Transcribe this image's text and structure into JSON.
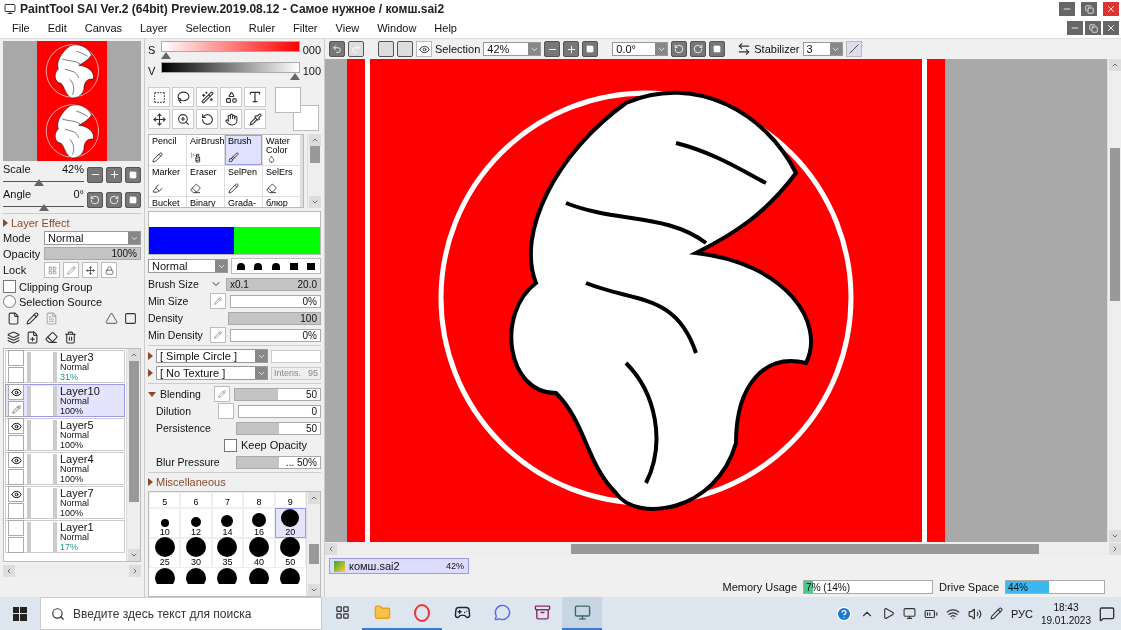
{
  "window": {
    "title": "PaintTool SAI Ver.2 (64bit) Preview.2019.08.12 - Самое нужное / комш.sai2"
  },
  "menu": [
    {
      "label": "File"
    },
    {
      "label": "Edit"
    },
    {
      "label": "Canvas"
    },
    {
      "label": "Layer"
    },
    {
      "label": "Selection"
    },
    {
      "label": "Ruler"
    },
    {
      "label": "Filter"
    },
    {
      "label": "View"
    },
    {
      "label": "Window"
    },
    {
      "label": "Help"
    }
  ],
  "navigator": {
    "scale": {
      "label": "Scale",
      "value": "42%",
      "level": 0.45
    },
    "angle": {
      "label": "Angle",
      "value": "0°",
      "level": 0.5
    }
  },
  "layer_effect": {
    "header": "Layer Effect",
    "mode": {
      "label": "Mode",
      "value": "Normal"
    },
    "opacity": {
      "label": "Opacity",
      "value": "100%",
      "level": 1
    },
    "lock": {
      "label": "Lock"
    },
    "clipping_group": {
      "label": "Clipping Group",
      "checked": false
    },
    "selection_source": {
      "label": "Selection Source",
      "selected": false
    }
  },
  "layers": [
    {
      "name": "Layer3",
      "mode": "Normal",
      "opacity": "31%",
      "reduced": true,
      "visible": false,
      "editing": false,
      "selected": false
    },
    {
      "name": "Layer10",
      "mode": "Normal",
      "opacity": "100%",
      "reduced": false,
      "visible": true,
      "editing": true,
      "selected": true
    },
    {
      "name": "Layer5",
      "mode": "Normal",
      "opacity": "100%",
      "reduced": false,
      "visible": true,
      "editing": false,
      "selected": false
    },
    {
      "name": "Layer4",
      "mode": "Normal",
      "opacity": "100%",
      "reduced": false,
      "visible": true,
      "editing": false,
      "selected": false
    },
    {
      "name": "Layer7",
      "mode": "Normal",
      "opacity": "100%",
      "reduced": false,
      "visible": true,
      "editing": false,
      "selected": false
    },
    {
      "name": "Layer1",
      "mode": "Normal",
      "opacity": "17%",
      "reduced": true,
      "visible": false,
      "editing": false,
      "selected": false
    }
  ],
  "color": {
    "s": {
      "label": "S",
      "value": "000",
      "level": 0
    },
    "v": {
      "label": "V",
      "value": "100",
      "level": 1
    }
  },
  "brush_tools": [
    {
      "label": "Pencil",
      "selected": false
    },
    {
      "label": "AirBrush",
      "selected": false
    },
    {
      "label": "Brush",
      "selected": true
    },
    {
      "label": "Water Color",
      "selected": false
    },
    {
      "label": "Marker",
      "selected": false
    },
    {
      "label": "Eraser",
      "selected": false
    },
    {
      "label": "SelPen",
      "selected": false
    },
    {
      "label": "SelErs",
      "selected": false
    },
    {
      "label": "Bucket",
      "selected": false
    },
    {
      "label": "Binary",
      "selected": false
    },
    {
      "label": "Grada-",
      "selected": false
    },
    {
      "label": "блюр",
      "selected": false
    }
  ],
  "brush": {
    "mode": "Normal",
    "params": [
      {
        "label": "Brush Size",
        "prefix": "x0.1",
        "value": "20.0",
        "level": 1
      },
      {
        "label": "Min Size",
        "value": "0%",
        "level": 0
      },
      {
        "label": "Density",
        "value": "100",
        "level": 1
      },
      {
        "label": "Min Density",
        "value": "0%",
        "level": 0
      }
    ],
    "shape": "[ Simple Circle ]",
    "texture": "[ No Texture ]",
    "intensity": "Intens.",
    "intensity_value": "95",
    "blending": [
      {
        "label": "Blending",
        "value": "50",
        "level": 0.5
      },
      {
        "label": "Dilution",
        "value": "0",
        "level": 0,
        "checked": false
      },
      {
        "label": "Persistence",
        "value": "50",
        "level": 0.5
      }
    ],
    "keep_opacity": {
      "label": "Keep Opacity",
      "checked": false
    },
    "blur_pressure": {
      "label": "Blur Pressure",
      "value": "... 50%",
      "level": 0.5
    },
    "misc_header": "Miscellaneous"
  },
  "brush_sizes": [
    {
      "label": "5",
      "selected": false
    },
    {
      "label": "6",
      "selected": false
    },
    {
      "label": "7",
      "selected": false
    },
    {
      "label": "8",
      "selected": false
    },
    {
      "label": "9",
      "selected": false
    },
    {
      "label": "10",
      "selected": false
    },
    {
      "label": "12",
      "selected": false
    },
    {
      "label": "14",
      "selected": false
    },
    {
      "label": "16",
      "selected": false
    },
    {
      "label": "20",
      "selected": true
    },
    {
      "label": "25",
      "selected": false
    },
    {
      "label": "30",
      "selected": false
    },
    {
      "label": "35",
      "selected": false
    },
    {
      "label": "40",
      "selected": false
    },
    {
      "label": "50",
      "selected": false
    }
  ],
  "canvas_toolbar": {
    "selection": "Selection",
    "zoom": "42%",
    "angle": "0.0°",
    "stabilizer_label": "Stabilizer",
    "stabilizer": "3"
  },
  "documents": [
    {
      "name": "комш.sai2",
      "zoom": "42%",
      "selected": true
    }
  ],
  "status": {
    "memory": {
      "label": "Memory Usage",
      "value": "7% (14%)",
      "level": 0.07
    },
    "drive": {
      "label": "Drive Space",
      "value": "44%",
      "level": 0.44
    }
  },
  "taskbar": {
    "search_placeholder": "Введите здесь текст для поиска",
    "language": "РУС",
    "time": "18:43",
    "date": "19.01.2023"
  }
}
